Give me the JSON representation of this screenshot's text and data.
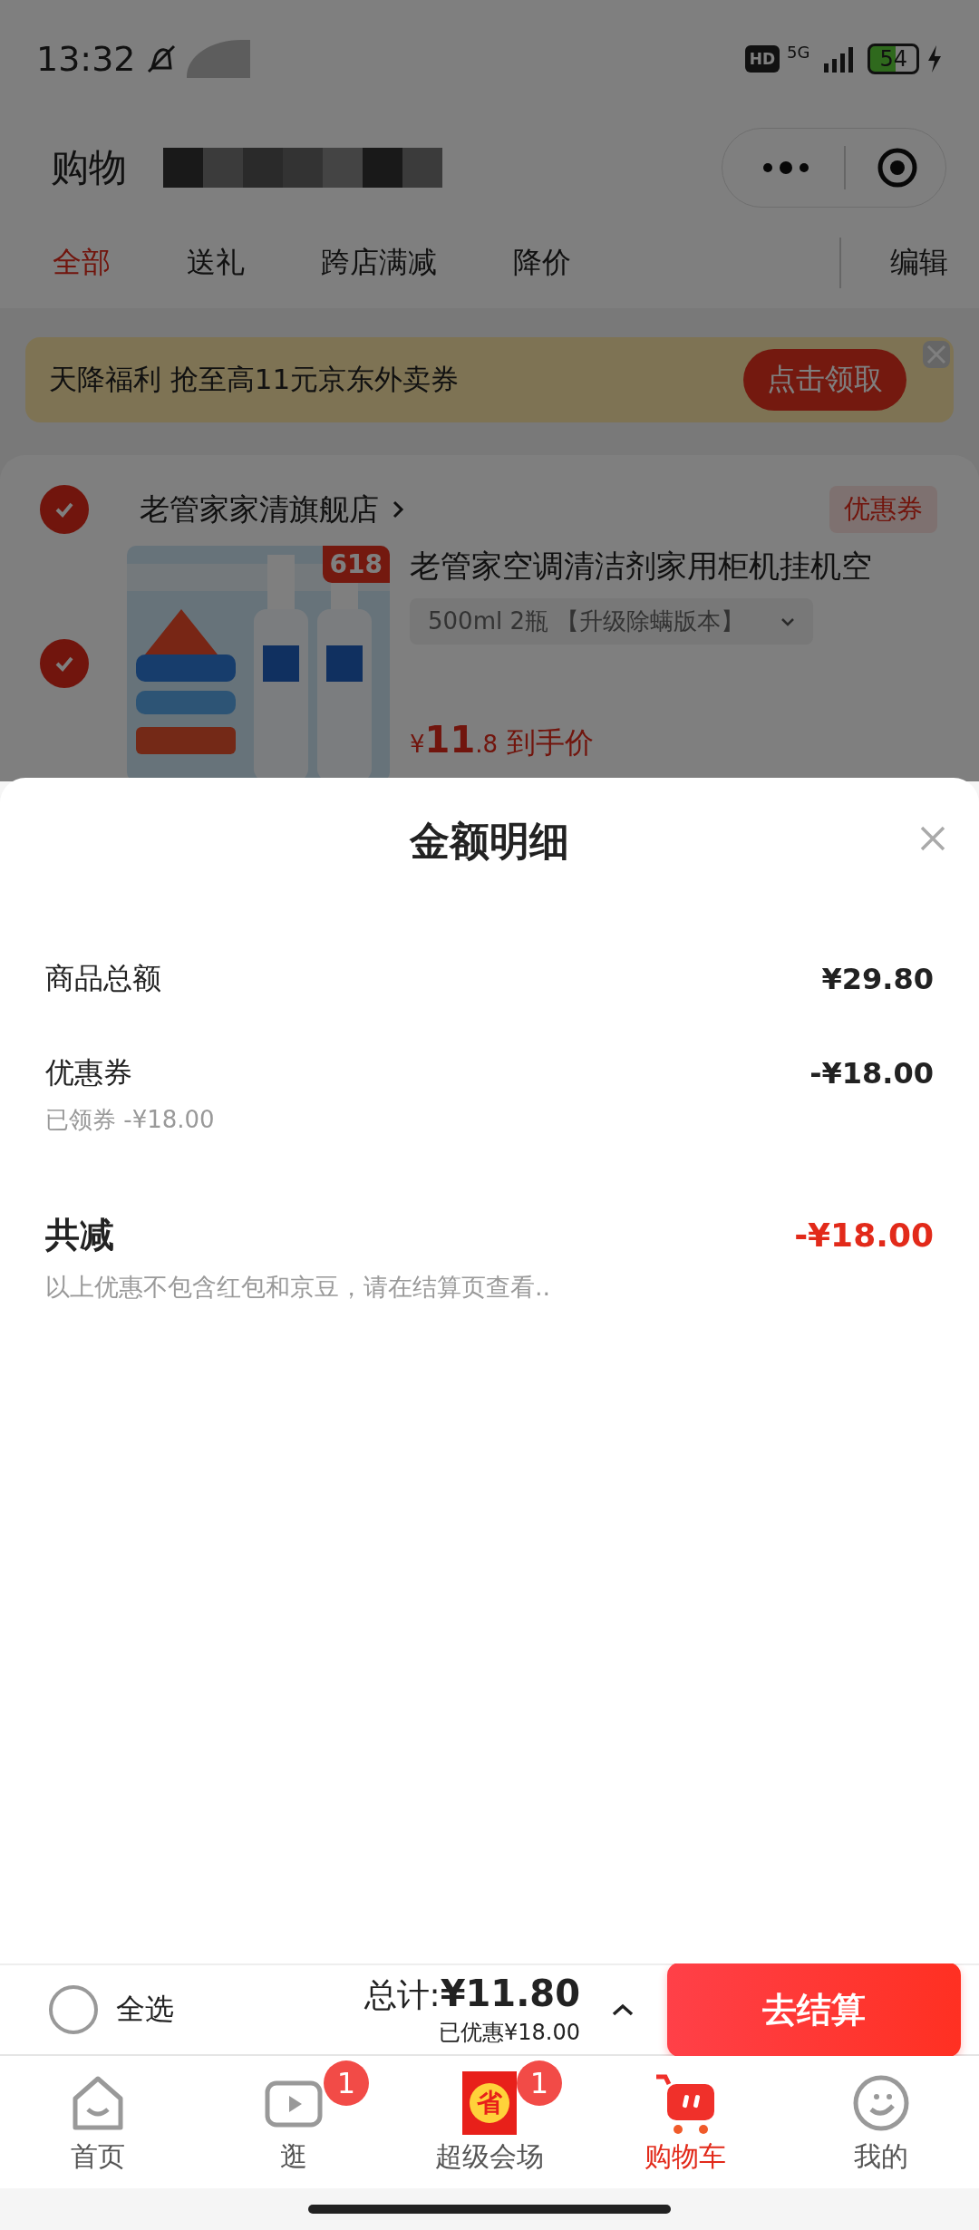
{
  "status_bar": {
    "time": "13:32",
    "hd": "HD",
    "network": "5G",
    "battery": "54"
  },
  "header": {
    "title": "购物"
  },
  "tabs": [
    {
      "label": "全部",
      "selected": true
    },
    {
      "label": "送礼",
      "selected": false
    },
    {
      "label": "跨店满减",
      "selected": false
    },
    {
      "label": "降价",
      "selected": false
    }
  ],
  "edit": "编辑",
  "banner": {
    "text": "天降福利 抢至高11元京东外卖券",
    "button": "点击领取"
  },
  "store": {
    "checked": true,
    "name": "老管家家清旗舰店",
    "coupon": "优惠券"
  },
  "product": {
    "checked": true,
    "badge": "618",
    "title": "老管家空调清洁剂家用柜机挂机空",
    "spec": "500ml 2瓶 【升级除螨版本】",
    "currency": "¥",
    "price": "11",
    "decimal": ".8",
    "price_note": "到手价"
  },
  "sheet": {
    "title": "金额明细",
    "rows": [
      {
        "label": "商品总额",
        "value": "¥29.80"
      },
      {
        "label": "优惠券",
        "value": "-¥18.00",
        "sub": "已领券 -¥18.00"
      }
    ],
    "total": {
      "label": "共减",
      "value": "-¥18.00"
    },
    "note": "以上优惠不包含红包和京豆，请在结算页查看.."
  },
  "checkout_bar": {
    "select_all": {
      "label": "全选",
      "checked": false
    },
    "total_label": "总计:",
    "total": "¥11.80",
    "saved": "已优惠¥18.00",
    "button": "去结算"
  },
  "tab_bar": [
    {
      "label": "首页",
      "selected": false
    },
    {
      "label": "逛",
      "selected": false,
      "badge": "1"
    },
    {
      "label": "超级会场",
      "selected": false,
      "badge": "1",
      "icon_text": "省"
    },
    {
      "label": "购物车",
      "selected": true
    },
    {
      "label": "我的",
      "selected": false
    }
  ]
}
